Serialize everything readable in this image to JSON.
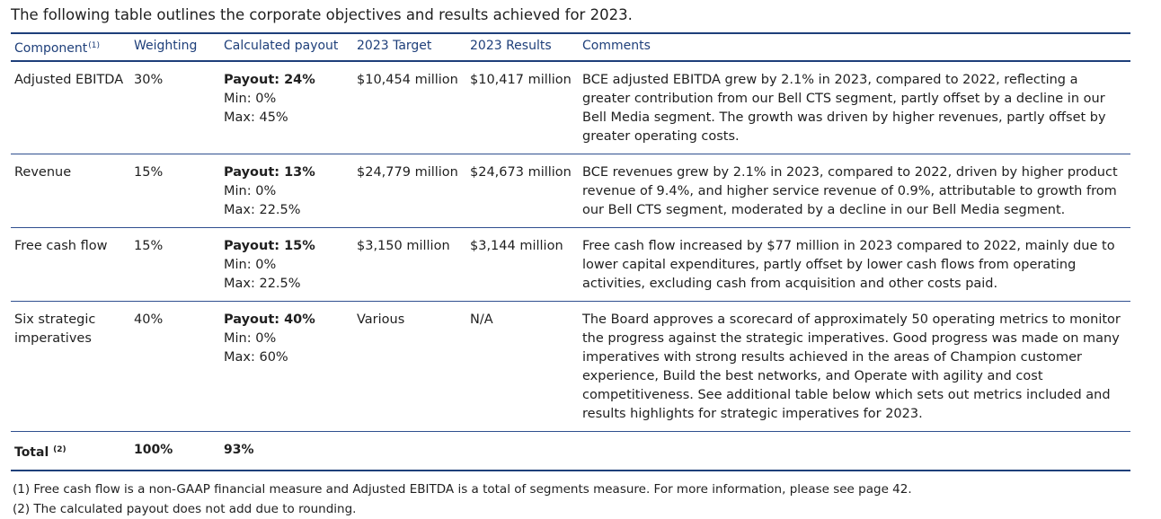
{
  "intro": "The following table outlines the corporate objectives and results achieved for 2023.",
  "table": {
    "headers": {
      "component": "Component",
      "component_note": "(1)",
      "weighting": "Weighting",
      "payout": "Calculated payout",
      "target": "2023 Target",
      "results": "2023 Results",
      "comments": "Comments"
    },
    "rows": [
      {
        "component": "Adjusted EBITDA",
        "weighting": "30%",
        "payout": "Payout: 24%",
        "min": "Min: 0%",
        "max": "Max: 45%",
        "target": "$10,454 million",
        "results": "$10,417 million",
        "comments": "BCE adjusted EBITDA grew by 2.1% in 2023, compared to 2022, reflecting a greater contribution from our Bell CTS segment, partly offset by a decline in our Bell Media segment. The growth was driven by higher revenues, partly offset by greater operating costs."
      },
      {
        "component": "Revenue",
        "weighting": "15%",
        "payout": "Payout: 13%",
        "min": "Min: 0%",
        "max": "Max: 22.5%",
        "target": "$24,779 million",
        "results": "$24,673 million",
        "comments": "BCE revenues grew by 2.1% in 2023, compared to 2022, driven by higher product revenue of 9.4%, and higher service revenue of 0.9%, attributable to growth from our Bell CTS segment, moderated by a decline in our Bell Media segment."
      },
      {
        "component": "Free cash flow",
        "weighting": "15%",
        "payout": "Payout: 15%",
        "min": "Min: 0%",
        "max": "Max: 22.5%",
        "target": "$3,150 million",
        "results": "$3,144 million",
        "comments": "Free cash flow increased by $77 million in 2023 compared to 2022, mainly due to lower capital expenditures, partly offset by lower cash flows from operating activities, excluding cash from acquisition and other costs paid."
      },
      {
        "component": "Six strategic imperatives",
        "weighting": "40%",
        "payout": "Payout: 40%",
        "min": "Min: 0%",
        "max": "Max: 60%",
        "target": "Various",
        "results": "N/A",
        "comments": "The Board approves a scorecard of approximately 50 operating metrics to monitor the progress against the strategic imperatives. Good progress was made on many imperatives with strong results achieved in the areas of Champion customer experience, Build the best networks, and Operate with agility and cost competitiveness. See additional table below which sets out metrics included and results highlights for strategic imperatives for 2023."
      }
    ],
    "total": {
      "label": "Total",
      "note": "(2)",
      "weighting": "100%",
      "payout": "93%"
    }
  },
  "footnotes": [
    "(1)  Free cash flow is a non-GAAP financial measure and Adjusted EBITDA is a total of segments measure. For more information, please see page 42.",
    "(2)  The calculated payout does not add due to rounding."
  ],
  "colors": {
    "header_text": "#1e3f7a",
    "rule": "#1e3f7a"
  }
}
